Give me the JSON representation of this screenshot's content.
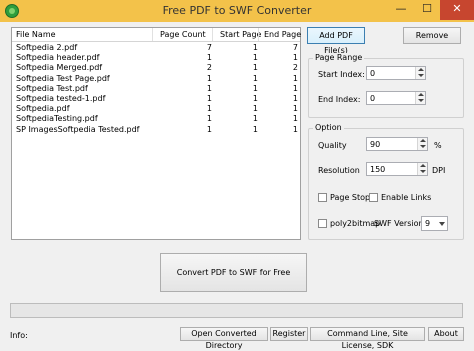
{
  "window": {
    "title": "Free PDF to SWF Converter",
    "minimize_glyph": "—",
    "maximize_glyph": "☐",
    "close_glyph": "✕"
  },
  "file_list": {
    "columns": [
      "File Name",
      "Page Count",
      "Start Page",
      "End Page"
    ],
    "rows": [
      [
        "Softpedia 2.pdf",
        "7",
        "1",
        "7"
      ],
      [
        "Softpedia header.pdf",
        "1",
        "1",
        "1"
      ],
      [
        "Softpedia Merged.pdf",
        "2",
        "1",
        "2"
      ],
      [
        "Softpedia Test Page.pdf",
        "1",
        "1",
        "1"
      ],
      [
        "Softpedia Test.pdf",
        "1",
        "1",
        "1"
      ],
      [
        "Softpedia tested-1.pdf",
        "1",
        "1",
        "1"
      ],
      [
        "Softpedia.pdf",
        "1",
        "1",
        "1"
      ],
      [
        "SoftpediaTesting.pdf",
        "1",
        "1",
        "1"
      ],
      [
        "SP ImagesSoftpedia Tested.pdf",
        "1",
        "1",
        "1"
      ]
    ]
  },
  "buttons": {
    "add": "Add PDF File(s)",
    "remove": "Remove",
    "convert": "Convert PDF to SWF for Free",
    "open_dir": "Open Converted Directory",
    "register": "Register",
    "command_line": "Command Line, Site License, SDK",
    "about": "About"
  },
  "page_range": {
    "title": "Page Range",
    "start_label": "Start Index:",
    "start_value": "0",
    "end_label": "End Index:",
    "end_value": "0"
  },
  "option": {
    "title": "Option",
    "quality_label": "Quality",
    "quality_value": "90",
    "quality_unit": "%",
    "resolution_label": "Resolution",
    "resolution_value": "150",
    "resolution_unit": "DPI",
    "page_stop_label": "Page Stop",
    "enable_links_label": "Enable Links",
    "poly2bitmap_label": "poly2bitmap",
    "swf_version_label": "SWF Version",
    "swf_version_value": "9"
  },
  "progress": {
    "fraction": 0.0
  },
  "status": {
    "info_label": "Info:"
  },
  "colors": {
    "titlebar": "#f3c24a",
    "close_button": "#c7462f",
    "window_bg": "#f0f0f0"
  }
}
